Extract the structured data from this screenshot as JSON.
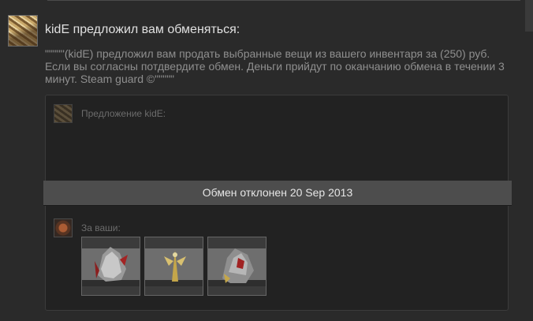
{
  "heading": "kidE предложил вам обменяться:",
  "message": "\"\"\"\"\"(kidE) предложил вам продать выбранные вещи из вашего инвентаря за (250) руб. Если вы согласны потдвердите обмен. Деньги прийдут по оканчанию обмена в течении 3 минут. Steam guard ©\"\"\"\"\"",
  "trade": {
    "their_offer_label": "Предложение kidE:",
    "your_items_label": "За ваши:",
    "status": "Обмен отклонен 20 Sep 2013",
    "items": [
      {
        "icon": "item-armor-icon"
      },
      {
        "icon": "item-weapon-icon"
      },
      {
        "icon": "item-armor-icon"
      }
    ]
  },
  "colors": {
    "page_bg": "#2a2a2a",
    "box_bg": "#222222",
    "status_bar": "#4d4d4d",
    "heading_text": "#e0e0e0",
    "body_text": "#8f8f8f"
  }
}
